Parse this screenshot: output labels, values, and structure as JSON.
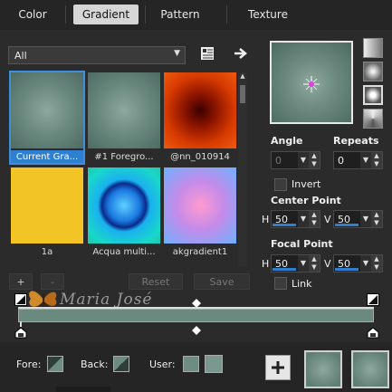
{
  "tabs": [
    "Color",
    "Gradient",
    "Pattern",
    "Texture"
  ],
  "selected_tab": "Gradient",
  "filter": {
    "value": "All"
  },
  "gradients": [
    {
      "label": "Current Gra...",
      "selected": true
    },
    {
      "label": "#1 Foregro..."
    },
    {
      "label": "@nn_010914"
    },
    {
      "label": "1a"
    },
    {
      "label": "Acqua multi..."
    },
    {
      "label": "akgradient1"
    }
  ],
  "list_buttons": {
    "add": "+",
    "remove": "-",
    "reset": "Reset",
    "save": "Save"
  },
  "angle": {
    "label": "Angle",
    "value": "0"
  },
  "repeats": {
    "label": "Repeats",
    "value": "0"
  },
  "invert": {
    "label": "Invert"
  },
  "center_point": {
    "label": "Center Point",
    "h_label": "H",
    "h": "50",
    "v_label": "V",
    "v": "50"
  },
  "focal_point": {
    "label": "Focal Point",
    "h_label": "H",
    "h": "50",
    "v_label": "V",
    "v": "50"
  },
  "link": {
    "label": "Link"
  },
  "watermark": "Maria José",
  "footer": {
    "fore": "Fore:",
    "back": "Back:",
    "user": "User:"
  },
  "colors": {
    "accent": "#2f7fd0",
    "gradient_mid": "#6f8c82",
    "gradient_dark": "#4b6a60"
  }
}
